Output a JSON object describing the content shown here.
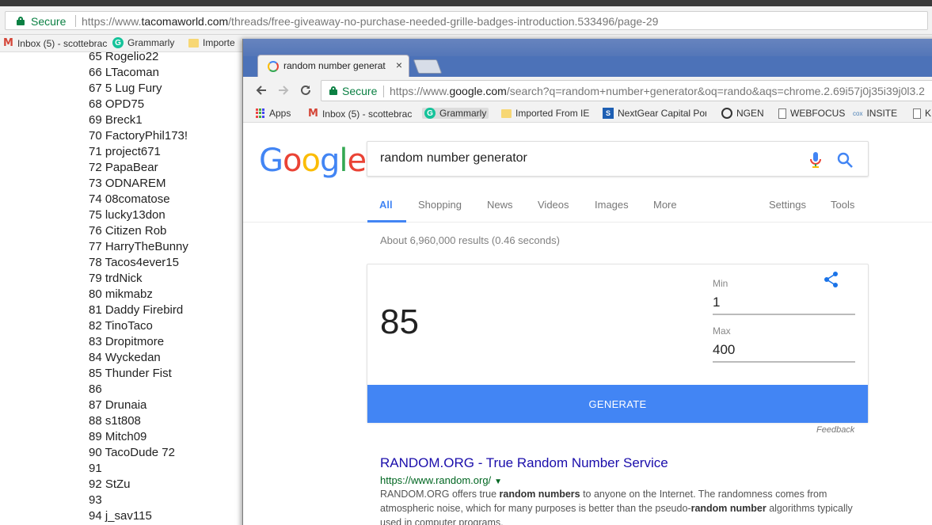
{
  "bg_browser": {
    "secure_label": "Secure",
    "url_prefix": "https://www.",
    "url_domain": "tacomaworld.com",
    "url_path": "/threads/free-giveaway-no-purchase-needed-grille-badges-introduction.533496/page-29",
    "bookmarks": [
      "Inbox (5) - scottebrac",
      "Grammarly",
      "Importe"
    ]
  },
  "forum_list": [
    "65 Rogelio22",
    "66 LTacoman",
    "67 5 Lug Fury",
    "68 OPD75",
    "69 Breck1",
    "70 FactoryPhil173!",
    "71 project671",
    "72 PapaBear",
    "73 ODNAREM",
    "74 08comatose",
    "75 lucky13don",
    "76 Citizen Rob",
    "77 HarryTheBunny",
    "78 Tacos4ever15",
    "79 trdNick",
    "80 mikmabz",
    "81 Daddy Firebird",
    "82 TinoTaco",
    "83 Dropitmore",
    "84 Wyckedan",
    "85 Thunder Fist",
    "86",
    "87 Drunaia",
    "88 s1t808",
    "89 Mitch09",
    "90 TacoDude 72",
    "91",
    "92 StZu",
    "93",
    "94 j_sav115"
  ],
  "fg_browser": {
    "tab_title": "random number generat",
    "tab_close": "×",
    "secure_label": "Secure",
    "url_prefix": "https://www.",
    "url_domain": "google.com",
    "url_path": "/search?q=random+number+generator&oq=rando&aqs=chrome.2.69i57j0j35i39j0l3.2",
    "bookmarks": {
      "apps": "Apps",
      "inbox": "Inbox (5) - scottebrac",
      "grammarly": "Grammarly",
      "imported": "Imported From IE",
      "nextgear": "NextGear Capital Por",
      "ngen": "NGEN",
      "webfocus": "WEBFOCUS",
      "insite": "INSITE",
      "cox_icon": "cox",
      "last": "K"
    }
  },
  "google": {
    "logo_letters": [
      "G",
      "o",
      "o",
      "g",
      "l",
      "e"
    ],
    "logo_colors": [
      "#4285f4",
      "#ea4335",
      "#fbbc05",
      "#4285f4",
      "#34a853",
      "#ea4335"
    ],
    "query": "random number generator",
    "tabs": [
      "All",
      "Shopping",
      "News",
      "Videos",
      "Images",
      "More"
    ],
    "tools": [
      "Settings",
      "Tools"
    ],
    "stats": "About 6,960,000 results (0.46 seconds)"
  },
  "rng": {
    "result": "85",
    "min_label": "Min",
    "min_value": "1",
    "max_label": "Max",
    "max_value": "400",
    "generate_label": "GENERATE",
    "feedback": "Feedback"
  },
  "first_result": {
    "title": "RANDOM.ORG - True Random Number Service",
    "url": "https://www.random.org/",
    "snippet_parts": [
      "RANDOM.ORG offers true ",
      "random numbers",
      " to anyone on the Internet. The randomness comes from atmospheric noise, which for many purposes is better than the pseudo-",
      "random number",
      " algorithms typically used in computer programs."
    ]
  },
  "colors": {
    "google_blue": "#4285f4",
    "link_blue": "#1a0dab",
    "url_green": "#006621",
    "secure_green": "#0b8043"
  }
}
